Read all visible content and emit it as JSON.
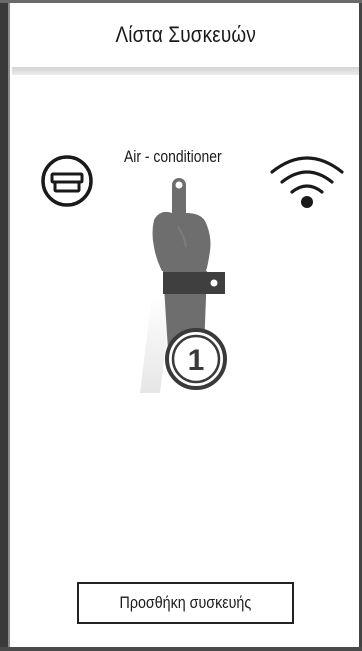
{
  "header": {
    "title": "Λίστα Συσκευών"
  },
  "device": {
    "name": "Air - conditioner",
    "icon": "air-conditioner-icon",
    "status_icon": "wifi-icon"
  },
  "tutorial": {
    "step_number": "1",
    "icon": "pointing-hand-icon"
  },
  "actions": {
    "add_device_label": "Προσθήκη συσκευής"
  },
  "colors": {
    "frame": "#3a3a3a",
    "hand": "#6e6e6e",
    "ink": "#1a1a1a",
    "header_shadow": "#d4d4d4"
  }
}
